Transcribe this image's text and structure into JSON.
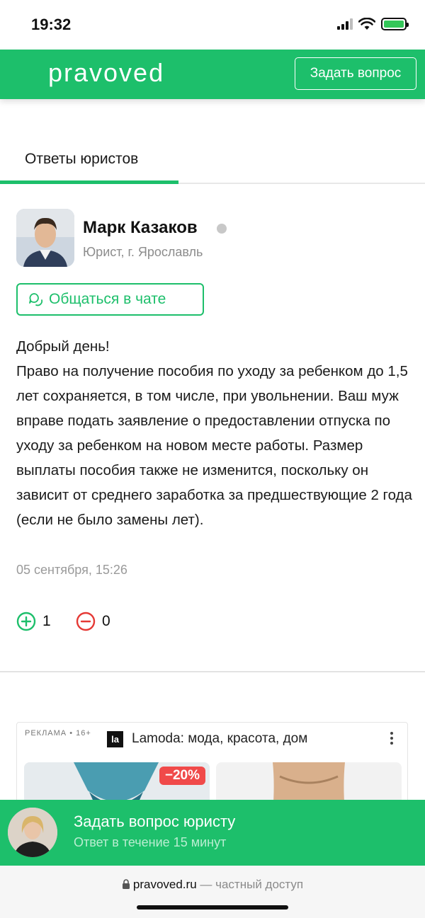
{
  "status_bar": {
    "time": "19:32"
  },
  "header": {
    "logo": "pravoved",
    "ask_button": "Задать вопрос"
  },
  "tabs": [
    {
      "label": "Ответы юристов",
      "active": true
    }
  ],
  "answer": {
    "lawyer_name": "Марк Казаков",
    "lawyer_role": "Юрист, г. Ярославль",
    "chat_button": "Общаться в чате",
    "text": "Добрый день!\nПраво на получение пособия по уходу за ребенком до 1,5 лет сохраняется, в том числе, при увольнении. Ваш муж вправе подать заявление о предоставлении отпуска по уходу за ребенком на новом месте работы. Размер выплаты пособия также не изменится, поскольку он зависит от среднего заработка за предшествующие 2 года (если не было замены лет).",
    "date": "05 сентября, 15:26",
    "votes_up": "1",
    "votes_down": "0"
  },
  "ad": {
    "label": "РЕКЛАМА • 16+",
    "logo_text": "la",
    "title": "Lamoda: мода, красота, дом",
    "discount": "−20%"
  },
  "bottom_promo": {
    "title": "Задать вопрос юристу",
    "subtitle": "Ответ в течение 15 минут"
  },
  "browser": {
    "domain": "pravoved.ru",
    "suffix": "— частный доступ"
  },
  "colors": {
    "brand": "#1dbf6b",
    "vote_down": "#e53935"
  }
}
